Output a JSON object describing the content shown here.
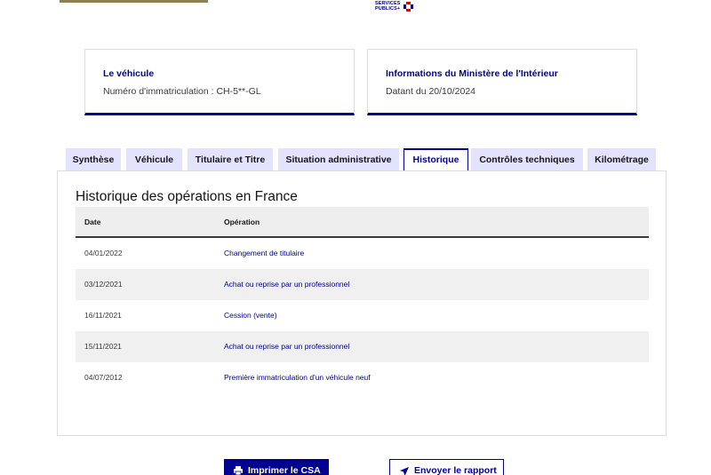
{
  "header": {
    "logo_text_line1": "SERVICES",
    "logo_text_line2": "PUBLICS+"
  },
  "cards": {
    "vehicle": {
      "title": "Le véhicule",
      "text": "Numéro d'immatriculation : CH-5**-GL"
    },
    "ministry": {
      "title": "Informations du Ministère de l'Intérieur",
      "text": "Datant du 20/10/2024"
    }
  },
  "tabs": [
    {
      "label": "Synthèse",
      "active": false
    },
    {
      "label": "Véhicule",
      "active": false
    },
    {
      "label": "Titulaire et Titre",
      "active": false
    },
    {
      "label": "Situation administrative",
      "active": false
    },
    {
      "label": "Historique",
      "active": true
    },
    {
      "label": "Contrôles techniques",
      "active": false
    },
    {
      "label": "Kilométrage",
      "active": false
    }
  ],
  "history": {
    "title": "Historique des opérations en France",
    "columns": [
      "Date",
      "Opération"
    ],
    "rows": [
      {
        "date": "04/01/2022",
        "operation": "Changement de titulaire"
      },
      {
        "date": "03/12/2021",
        "operation": "Achat ou reprise par un professionnel"
      },
      {
        "date": "16/11/2021",
        "operation": "Cession (vente)"
      },
      {
        "date": "15/11/2021",
        "operation": "Achat ou reprise par un professionnel"
      },
      {
        "date": "04/07/2012",
        "operation": "Première immatriculation d'un véhicule neuf"
      }
    ]
  },
  "actions": {
    "print_label": "Imprimer le CSA",
    "send_label": "Envoyer le rapport"
  },
  "colors": {
    "primary": "#000091",
    "tab_bg": "#e3e3fd",
    "gold": "#8b8151",
    "marianne_red": "#e1000f"
  }
}
